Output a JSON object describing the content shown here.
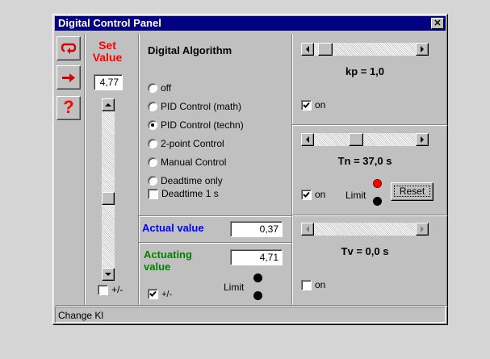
{
  "window": {
    "title": "Digital Control Panel",
    "close_symbol": "✕"
  },
  "toolbar": {
    "icons": [
      "loop-arrow-icon",
      "right-arrow-icon",
      "help-question-icon"
    ],
    "help_symbol": "?"
  },
  "setpoint": {
    "label": "Set Value",
    "value": "4,77",
    "slider_level": 0.44,
    "sign_toggle_label": "+/-",
    "sign_toggle_checked": false
  },
  "algorithm": {
    "heading": "Digital Algorithm",
    "options": [
      "off",
      "PID Control (math)",
      "PID Control (techn)",
      "2-point Control",
      "Manual Control",
      "Deadtime only"
    ],
    "selected_index": 2,
    "deadtime_label": "Deadtime 1 s",
    "deadtime_checked": false
  },
  "actual": {
    "label": "Actual value",
    "value": "0,37"
  },
  "actuating": {
    "label": "Actuating value",
    "value": "4,71",
    "sign_toggle_label": "+/-",
    "sign_toggle_checked": true,
    "limit_label": "Limit"
  },
  "params": {
    "kp": {
      "label": "kp = 1,0",
      "slider_level": 0.05,
      "on_label": "on",
      "on_checked": true
    },
    "tn": {
      "label": "Tn = 37,0 s",
      "slider_level": 0.4,
      "on_label": "on",
      "on_checked": true,
      "limit_label": "Limit",
      "reset_label": "Reset"
    },
    "tv": {
      "label": "Tv = 0,0 s",
      "slider_level": 0.0,
      "on_label": "on",
      "on_checked": false
    }
  },
  "status": {
    "text": "Change Kl"
  },
  "colors": {
    "title_bar": "#000080",
    "set_value_label": "#ff0000",
    "actual_label": "#0000ff",
    "actuating_label": "#008000",
    "led_red": "#ff0000",
    "led_black": "#000000",
    "window_face": "#c0c0c0"
  }
}
